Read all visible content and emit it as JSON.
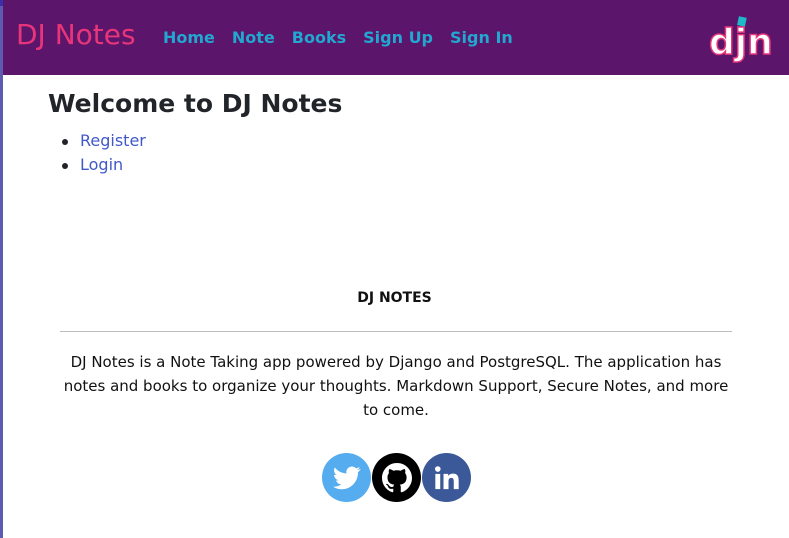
{
  "navbar": {
    "brand": "DJ Notes",
    "links": [
      "Home",
      "Note",
      "Books",
      "Sign Up",
      "Sign In"
    ],
    "logo_text": "djn",
    "logo_icon": "django-logo",
    "background": "#5b156b",
    "brand_color": "#e8357a",
    "link_color": "#22a7d1"
  },
  "main": {
    "title": "Welcome to DJ Notes",
    "links": [
      "Register",
      "Login"
    ],
    "link_color": "#4158c8"
  },
  "footer": {
    "title": "DJ NOTES",
    "description": "DJ Notes is a Note Taking app powered by Django and PostgreSQL. The application has notes and books to organize your thoughts. Markdown Support, Secure Notes, and more to come.",
    "socials": [
      {
        "icon": "twitter-icon",
        "color": "#55acee"
      },
      {
        "icon": "github-icon",
        "color": "#000000"
      },
      {
        "icon": "linkedin-icon",
        "color": "#3b5998"
      }
    ]
  }
}
